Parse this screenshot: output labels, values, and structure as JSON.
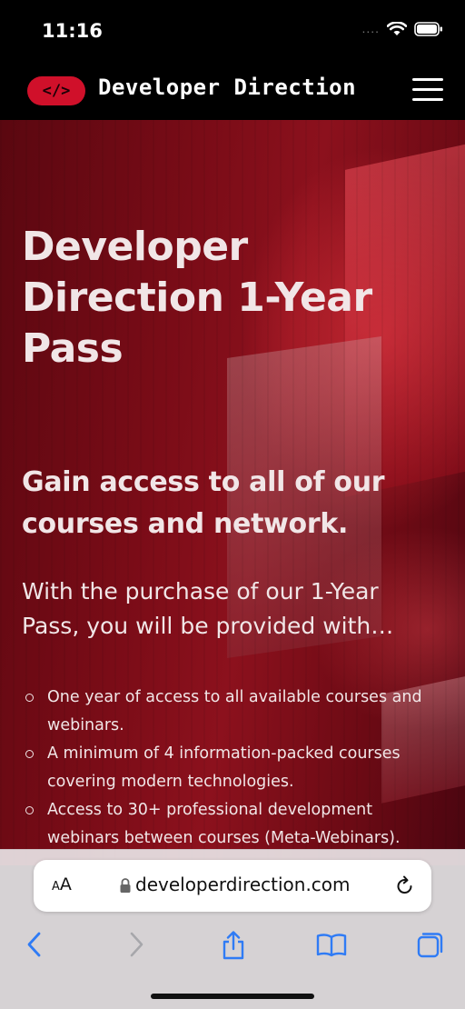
{
  "status_bar": {
    "time": "11:16",
    "signal": "....",
    "icons": [
      "wifi-icon",
      "battery-icon"
    ]
  },
  "header": {
    "logo_text": "</>",
    "brand": "Developer Direction",
    "menu_icon": "hamburger-icon",
    "colors": {
      "logo_bg": "#d0102a",
      "bar_bg": "#000000"
    }
  },
  "hero": {
    "title": "Developer Direction 1-Year Pass",
    "subtitle": "Gain access to all of our courses and network.",
    "intro": "With the purchase of our 1-Year Pass, you will be provided with…",
    "benefits": [
      "One year of access to all available courses and webinars.",
      "A minimum of 4 information-packed courses covering modern technologies.",
      "Access to 30+ professional development webinars between courses (Meta-Webinars)."
    ],
    "colors": {
      "accent": "#8c111d",
      "text": "#f1e6e7"
    }
  },
  "browser": {
    "text_size_small": "A",
    "text_size_big": "A",
    "url": "developerdirection.com",
    "icons": [
      "lock-icon",
      "reload-icon",
      "back-arrow-icon",
      "forward-arrow-icon",
      "share-icon",
      "bookmarks-icon",
      "tabs-icon"
    ],
    "colors": {
      "toolbar_tint": "#2f7bf5"
    }
  }
}
